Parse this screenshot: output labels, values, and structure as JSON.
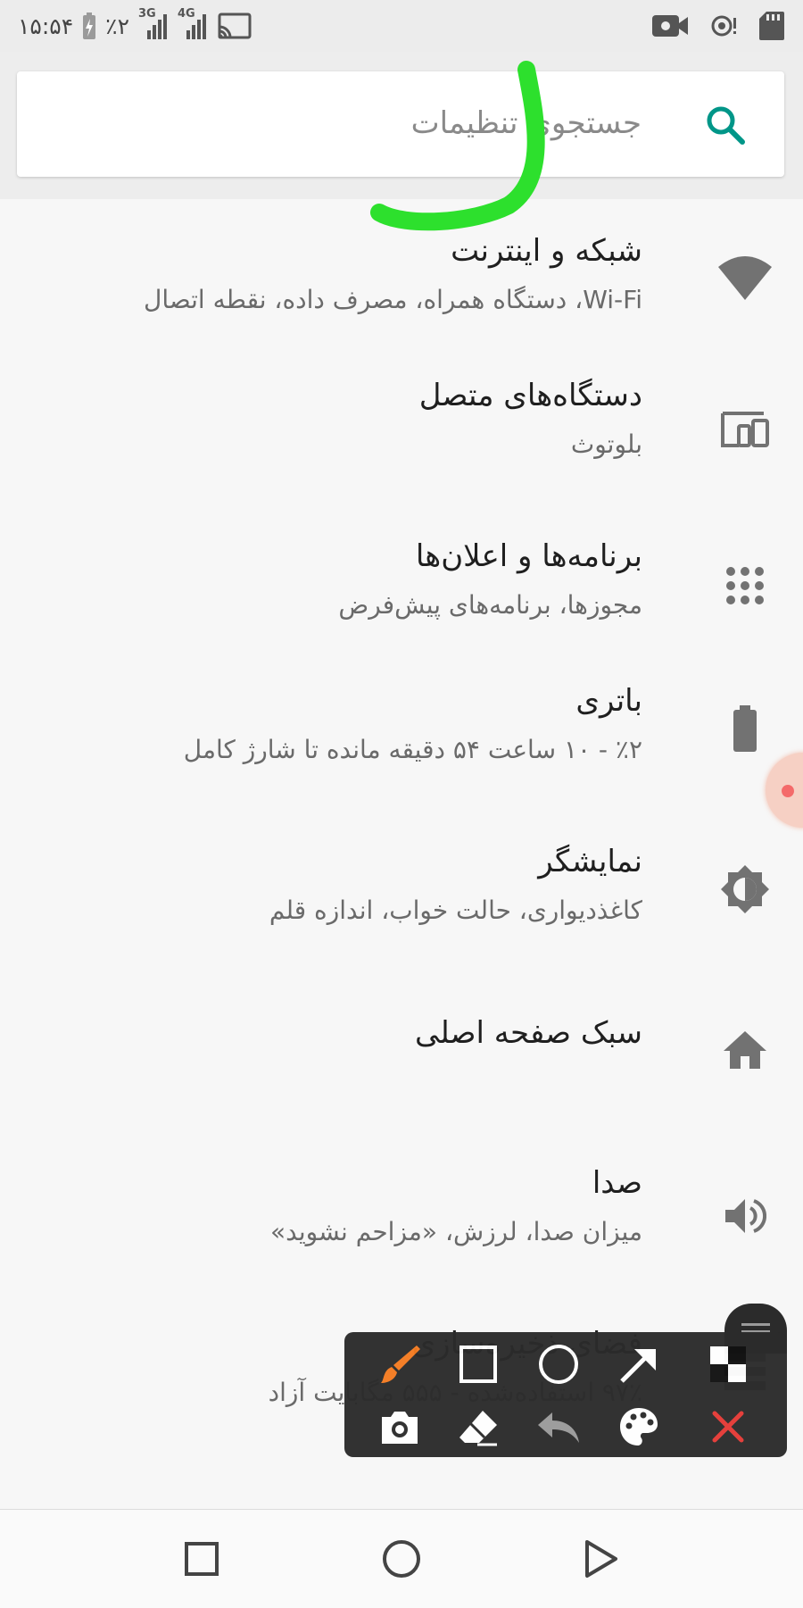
{
  "status_bar": {
    "time": "۱۵:۵۴",
    "battery": "٪۲",
    "network_1": "3G",
    "network_2": "4G",
    "icons": [
      "charging-battery-icon",
      "signal-3g-icon",
      "signal-4g-icon",
      "cast-icon",
      "video-record-icon",
      "hotspot-icon",
      "sd-card-icon"
    ]
  },
  "search": {
    "placeholder": "جستجوی تنظیمات"
  },
  "settings": {
    "items": [
      {
        "title": "شبکه و اینترنت",
        "subtitle": "Wi-Fi، دستگاه همراه، مصرف داده، نقطه اتصال",
        "icon": "wifi-icon"
      },
      {
        "title": "دستگاه‌های متصل",
        "subtitle": "بلوتوث",
        "icon": "connected-devices-icon"
      },
      {
        "title": "برنامه‌ها و اعلان‌ها",
        "subtitle": "مجوزها، برنامه‌های پیش‌فرض",
        "icon": "apps-grid-icon"
      },
      {
        "title": "باتری",
        "subtitle": "٪۲ - ۱۰ ساعت ۵۴ دقیقه مانده تا شارژ کامل",
        "icon": "battery-icon"
      },
      {
        "title": "نمایشگر",
        "subtitle": "کاغذدیواری، حالت خواب، اندازه قلم",
        "icon": "brightness-icon"
      },
      {
        "title": "سبک صفحه اصلی",
        "subtitle": "",
        "icon": "home-icon"
      },
      {
        "title": "صدا",
        "subtitle": "میزان صدا، لرزش، «مزاحم نشوید»",
        "icon": "volume-icon"
      },
      {
        "title": "فضای ذخیره‌سازی",
        "subtitle": "۹۷٪ استفاده‌شده - ۵۵۵ مگابایت آزاد",
        "icon": "storage-icon"
      }
    ]
  },
  "colors": {
    "accent": "#009688",
    "icon_gray": "#727272",
    "annotation_green": "#2de02d",
    "toolbar_bg": "#2b2b2b",
    "brush_orange": "#f47b20",
    "close_red": "#e53935"
  },
  "draw_toolbar": {
    "tools": [
      "brush-icon",
      "rectangle-icon",
      "circle-icon",
      "arrow-icon",
      "pattern-icon",
      "camera-icon",
      "eraser-icon",
      "undo-icon",
      "palette-icon",
      "close-icon"
    ]
  },
  "nav_bar": {
    "buttons": [
      "recents-button",
      "home-button",
      "back-button"
    ]
  }
}
